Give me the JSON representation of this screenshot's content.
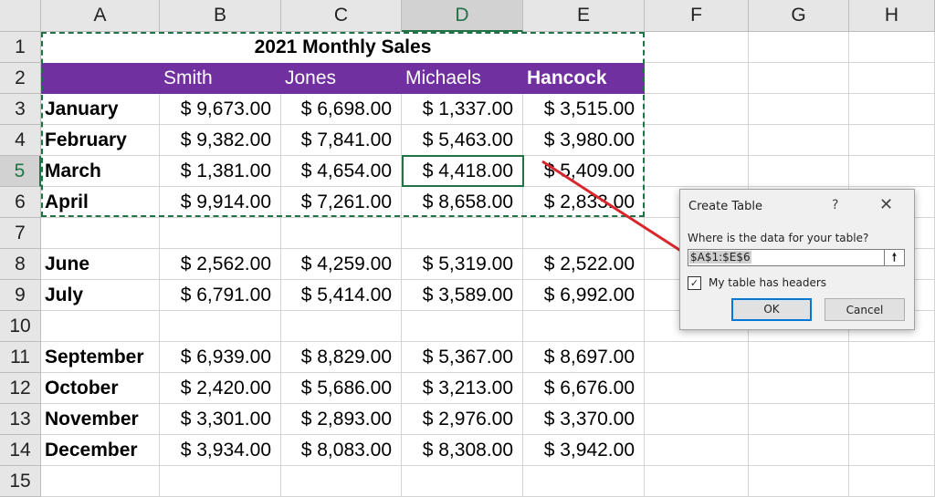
{
  "columns": [
    "A",
    "B",
    "C",
    "D",
    "E",
    "F",
    "G",
    "H"
  ],
  "selected_column": "D",
  "selected_row": 5,
  "rows": [
    {
      "n": 1,
      "title": "2021 Monthly Sales"
    },
    {
      "n": 2,
      "headers": [
        "",
        "Smith",
        "Jones",
        "Michaels",
        "Hancock"
      ]
    },
    {
      "n": 3,
      "month": "January",
      "values": [
        "$ 9,673.00",
        "$ 6,698.00",
        "$ 1,337.00",
        "$ 3,515.00"
      ]
    },
    {
      "n": 4,
      "month": "February",
      "values": [
        "$ 9,382.00",
        "$ 7,841.00",
        "$ 5,463.00",
        "$ 3,980.00"
      ]
    },
    {
      "n": 5,
      "month": "March",
      "values": [
        "$ 1,381.00",
        "$ 4,654.00",
        "$ 4,418.00",
        "$ 5,409.00"
      ]
    },
    {
      "n": 6,
      "month": "April",
      "values": [
        "$ 9,914.00",
        "$ 7,261.00",
        "$ 8,658.00",
        "$ 2,833.00"
      ]
    },
    {
      "n": 7
    },
    {
      "n": 8,
      "month": "June",
      "values": [
        "$ 2,562.00",
        "$ 4,259.00",
        "$ 5,319.00",
        "$ 2,522.00"
      ]
    },
    {
      "n": 9,
      "month": "July",
      "values": [
        "$ 6,791.00",
        "$ 5,414.00",
        "$ 3,589.00",
        "$ 6,992.00"
      ]
    },
    {
      "n": 10
    },
    {
      "n": 11,
      "month": "September",
      "values": [
        "$ 6,939.00",
        "$ 8,829.00",
        "$ 5,367.00",
        "$ 8,697.00"
      ]
    },
    {
      "n": 12,
      "month": "October",
      "values": [
        "$ 2,420.00",
        "$ 5,686.00",
        "$ 3,213.00",
        "$ 6,676.00"
      ]
    },
    {
      "n": 13,
      "month": "November",
      "values": [
        "$ 3,301.00",
        "$ 2,893.00",
        "$ 2,976.00",
        "$ 3,370.00"
      ]
    },
    {
      "n": 14,
      "month": "December",
      "values": [
        "$ 3,934.00",
        "$ 8,083.00",
        "$ 8,308.00",
        "$ 3,942.00"
      ]
    },
    {
      "n": 15
    }
  ],
  "colors": {
    "header_fill": "#7030a0",
    "selection": "#217346",
    "arrow": "#d9262c"
  },
  "dialog": {
    "title": "Create Table",
    "help": "?",
    "close": "✕",
    "prompt": "Where is the data for your table?",
    "range_value": "$A$1:$E$6",
    "collapse_icon": "🠕",
    "has_headers_label": "My table has headers",
    "has_headers_checked": true,
    "ok_label": "OK",
    "cancel_label": "Cancel"
  }
}
